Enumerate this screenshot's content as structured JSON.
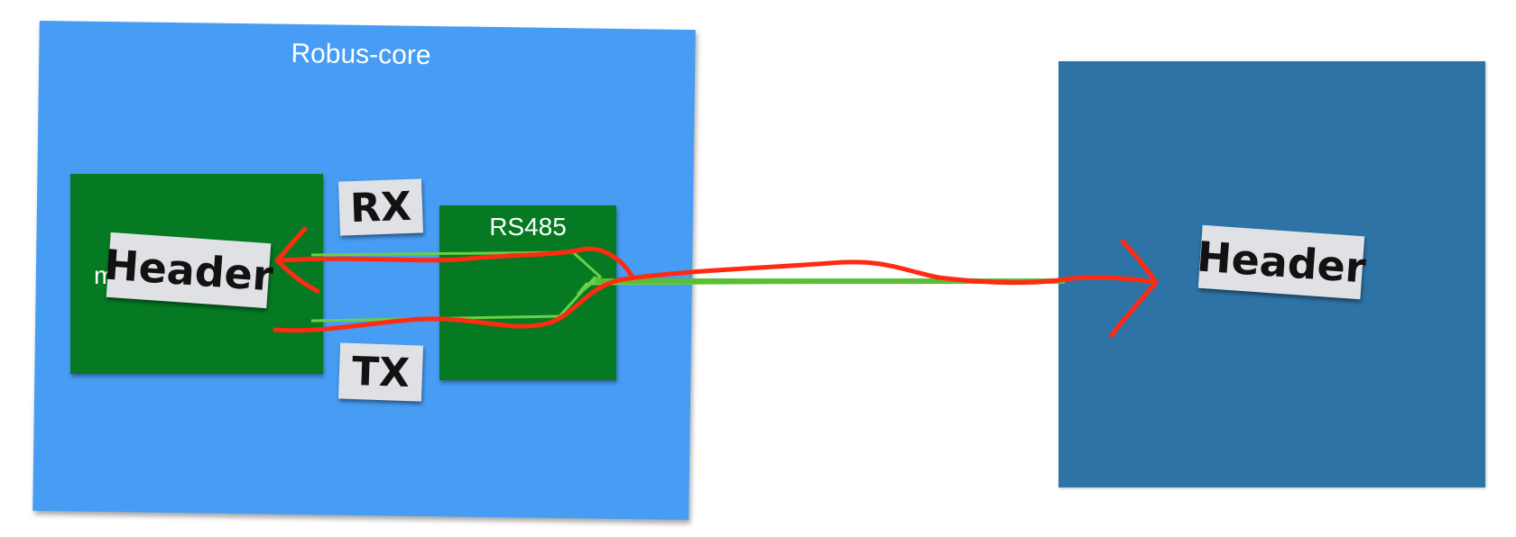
{
  "diagram": {
    "robus_core_label": "Robus-core",
    "mcu_label": "mcu",
    "mcu_label_tail": "ui",
    "rs485_label": "RS485",
    "tags": {
      "rx": "RX",
      "tx": "TX",
      "header_left": "Header",
      "header_right": "Header"
    }
  },
  "colors": {
    "board": "#479cf3",
    "component": "#057a23",
    "remote_board": "#2e73a6",
    "arrow": "#ff2a10",
    "bus_line": "#5bc33a"
  }
}
